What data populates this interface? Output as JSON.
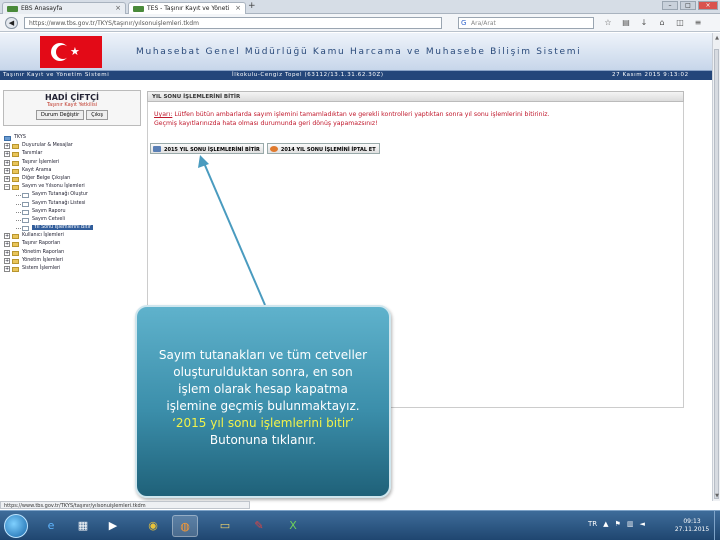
{
  "browser": {
    "tabs": [
      {
        "label": "EBS Anasayfa"
      },
      {
        "label": "TES - Taşınır Kayıt ve Yöneti"
      }
    ],
    "url": "https://www.tbs.gov.tr/TKYS/taşınır/yılsonuişlemleri.tkdm",
    "search_placeholder": "Ara/Arat"
  },
  "banner": {
    "title": "Muhasebat Genel Müdürlüğü Kamu Harcama ve Muhasebe Bilişim Sistemi"
  },
  "statusbar": {
    "app": "Taşınır Kayıt ve Yönetim Sistemi",
    "unit": "İlkokulu-Cengiz Topel (63112/13.1.31.62.30Z)",
    "date": "27 Kasım 2015 9:13:02"
  },
  "user": {
    "name": "HADİ ÇİFTÇİ",
    "role": "Taşınır Kayıt Yetkilisi",
    "change_label": "Durum Değiştir",
    "logout_label": "Çıkış"
  },
  "tree": {
    "root": "TKYS",
    "items": [
      {
        "label": "Duyurular & Mesajlar",
        "level": 0
      },
      {
        "label": "Tanımlar",
        "level": 0
      },
      {
        "label": "Taşınır İşlemleri",
        "level": 0
      },
      {
        "label": "Kayıt Arama",
        "level": 0
      },
      {
        "label": "Diğer Belge Çıkışları",
        "level": 0
      },
      {
        "label": "Sayım ve Yılsonu İşlemleri",
        "level": 0
      },
      {
        "label": "Sayım Tutanağı Oluştur",
        "level": 1
      },
      {
        "label": "Sayım Tutanağı Listesi",
        "level": 1
      },
      {
        "label": "Sayım Raporu",
        "level": 1
      },
      {
        "label": "Sayım Cetveli",
        "level": 1
      },
      {
        "label": "Yıl Sonu İşlemlerini Bitir",
        "level": 1,
        "selected": true
      },
      {
        "label": "Kullanıcı İşlemleri",
        "level": 0
      },
      {
        "label": "Taşınır Raporları",
        "level": 0
      },
      {
        "label": "Yönetim Raporları",
        "level": 0
      },
      {
        "label": "Yönetim İşlemleri",
        "level": 0
      },
      {
        "label": "Sistem İşlemleri",
        "level": 0
      }
    ]
  },
  "main": {
    "header": "YIL SONU İŞLEMLERİNİ BİTİR",
    "notice_label": "Uyarı:",
    "notice_text": "Lütfen bütün ambarlarda sayım işlemini tamamladıktan ve gerekli kontrolleri yaptıktan sonra yıl sonu işlemlerini bitiriniz.",
    "notice_text2": "Geçmiş kayıtlarınızda hata olması durumunda geri dönüş yapamazsınız!",
    "btn_finish": "2015 YIL SONU İŞLEMLERİNİ BİTİR",
    "btn_cancel": "2014 YIL SONU İŞLEMİNİ İPTAL ET"
  },
  "callout": {
    "line1": "Sayım tutanakları ve tüm cetveller",
    "line2": "oluşturulduktan sonra, en son",
    "line3": "işlem olarak hesap kapatma",
    "line4": "işlemine geçmiş bulunmaktayız.",
    "line5": "‘2015 yıl sonu işlemlerini bitir’",
    "line6": "Butonuna tıklanır."
  },
  "status_url": "https://www.tbs.gov.tr/TKYS/taşınır/yılsonuişlemleri.tkdm",
  "taskbar": {
    "time": "09:13",
    "date": "27.11.2015",
    "lang": "TR"
  },
  "colors": {
    "accent": "#24467a",
    "callout": "#3b8eaa",
    "notice": "#c0172b"
  }
}
